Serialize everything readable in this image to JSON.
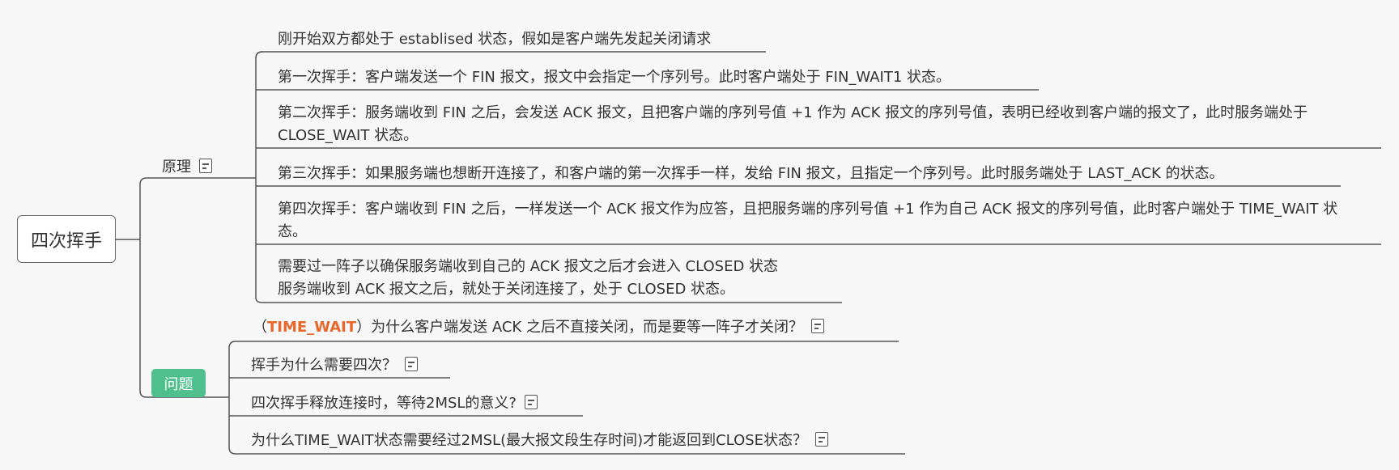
{
  "root": {
    "label": "四次挥手"
  },
  "principle": {
    "label": "原理",
    "items": [
      "刚开始双方都处于 establised 状态，假如是客户端先发起关闭请求",
      "第一次挥手：客户端发送一个 FIN 报文，报文中会指定一个序列号。此时客户端处于 FIN_WAIT1 状态。",
      "第二次挥手：服务端收到 FIN 之后，会发送 ACK 报文，且把客户端的序列号值 +1 作为 ACK 报文的序列号值，表明已经收到客户端的报文了，此时服务端处于 CLOSE_WAIT 状态。",
      "第三次挥手：如果服务端也想断开连接了，和客户端的第一次挥手一样，发给 FIN 报文，且指定一个序列号。此时服务端处于 LAST_ACK 的状态。",
      "第四次挥手：客户端收到 FIN 之后，一样发送一个 ACK 报文作为应答，且把服务端的序列号值 +1 作为自己 ACK 报文的序列号值，此时客户端处于 TIME_WAIT 状态。",
      "需要过一阵子以确保服务端收到自己的 ACK 报文之后才会进入 CLOSED 状态",
      "服务端收到 ACK 报文之后，就处于关闭连接了，处于 CLOSED 状态。"
    ]
  },
  "question": {
    "label": "问题",
    "q1_open": "（",
    "q1_accent": "TIME_WAIT",
    "q1_rest": "）为什么客户端发送 ACK 之后不直接关闭，而是要等一阵子才关闭？",
    "q2": "挥手为什么需要四次？",
    "q3": "四次挥手释放连接时，等待2MSL的意义?",
    "q4": "为什么TIME_WAIT状态需要经过2MSL(最大报文段生存时间)才能返回到CLOSE状态？"
  },
  "colors": {
    "accent": "#e8672a",
    "question_bg": "#4fc08d",
    "line": "#555555"
  },
  "icons": [
    "note-icon"
  ]
}
